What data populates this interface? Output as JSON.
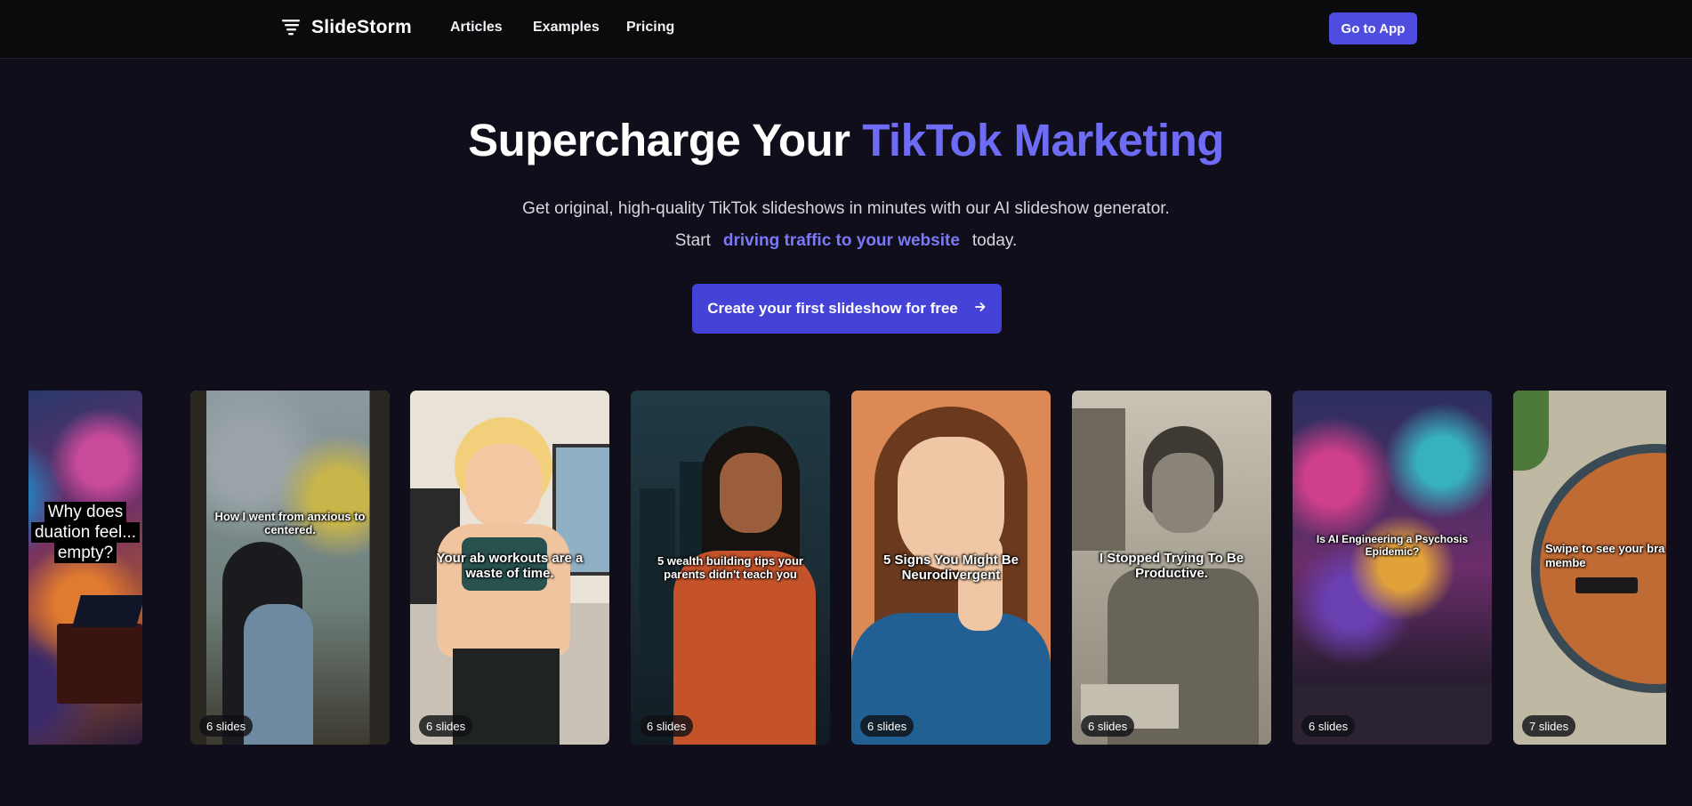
{
  "nav": {
    "logo_text": "SlideStorm",
    "links": [
      "Articles",
      "Examples",
      "Pricing"
    ],
    "cta_label": "Go to App"
  },
  "hero": {
    "title_main": "Supercharge Your ",
    "title_accent": "TikTok Marketing",
    "subtitle_line1": "Get original, high-quality TikTok slideshows in minutes with our AI slideshow generator.",
    "subtitle_start": "Start",
    "subtitle_highlight": "driving traffic to your website",
    "subtitle_end": "today.",
    "cta_label": "Create your first slideshow for free",
    "cta_icon": "arrow-right-icon"
  },
  "colors": {
    "accent": "#6e6cf5",
    "button": "#4542d8",
    "background": "#0f0e1a"
  },
  "slideshows": [
    {
      "caption_lines": [
        "Why does",
        "duation feel...",
        "empty?"
      ],
      "slides": ""
    },
    {
      "caption": "How I went from anxious to centered.",
      "slides": "6 slides"
    },
    {
      "caption": "Your ab workouts are a waste of time.",
      "slides": "6 slides"
    },
    {
      "caption": "5 wealth building tips your parents didn't teach you",
      "slides": "6 slides"
    },
    {
      "caption": "5 Signs You Might Be Neurodivergent",
      "slides": "6 slides"
    },
    {
      "caption": "I Stopped Trying To Be Productive.",
      "slides": "6 slides"
    },
    {
      "caption": "Is AI Engineering a Psychosis Epidemic?",
      "slides": "6 slides"
    },
    {
      "caption": "Swipe to see your bra parts as team membe",
      "slides": "7 slides"
    }
  ]
}
